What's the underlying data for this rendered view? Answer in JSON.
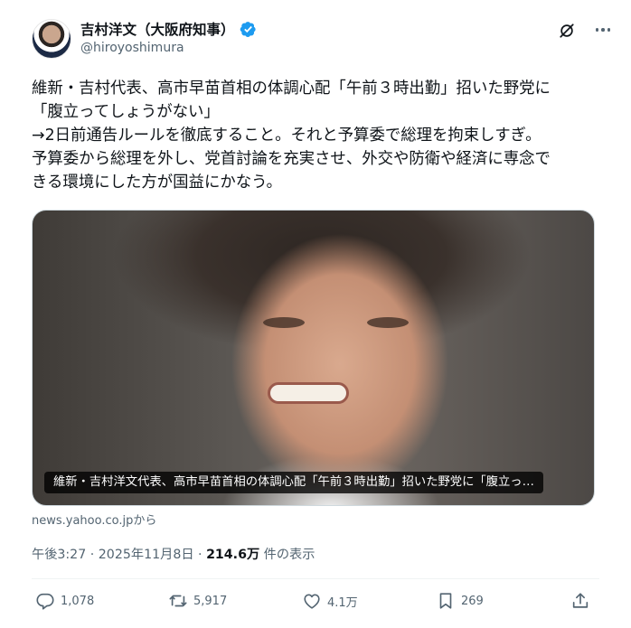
{
  "author": {
    "display_name": "吉村洋文（大阪府知事）",
    "handle": "@hiroyoshimura",
    "verified_badge_color": "#1d9bf0"
  },
  "icons": {
    "grok": "grok-icon",
    "more": "more-icon",
    "verified": "verified-badge-icon"
  },
  "tweet": {
    "lines": [
      "維新・吉村代表、高市早苗首相の体調心配「午前３時出勤」招いた野党に",
      "「腹立ってしょうがない」",
      "→2日前通告ルールを徹底すること。それと予算委で総理を拘束しすぎ。",
      "予算委から総理を外し、党首討論を充実させ、外交や防衛や経済に専念で",
      "きる環境にした方が国益にかなう。"
    ]
  },
  "card": {
    "caption": "維新・吉村洋文代表、高市早苗首相の体調心配「午前３時出勤」招いた野党に「腹立っ…",
    "source": "news.yahoo.co.jpから"
  },
  "meta": {
    "time": "午後3:27",
    "sep1": " · ",
    "date": "2025年11月8日",
    "sep2": " · ",
    "views_count": "214.6万",
    "views_label": " 件の表示"
  },
  "actions": {
    "reply_count": "1,078",
    "repost_count": "5,917",
    "like_count": "4.1万",
    "bookmark_count": "269"
  },
  "colors": {
    "text": "#0f1419",
    "secondary": "#536471",
    "divider": "#eff3f4"
  }
}
